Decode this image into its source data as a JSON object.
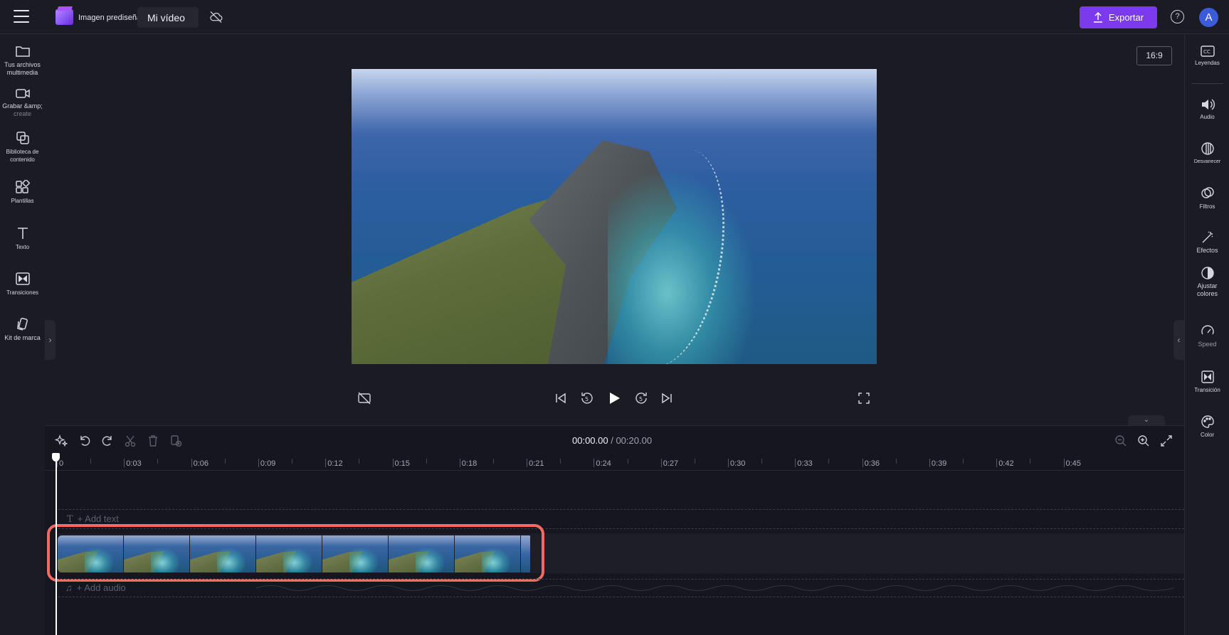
{
  "app": {
    "preset_label": "Imagen prediseñada",
    "project_title": "Mi vídeo",
    "export_label": "Exportar",
    "help": "?",
    "avatar_initial": "A",
    "accent": "#7c3aed",
    "highlight_color": "#f26a62"
  },
  "left_nav": [
    {
      "label": "Tus archivos multimedia",
      "icon": "folder-icon"
    },
    {
      "label": "Grabar &amp;",
      "sublabel": "create",
      "icon": "camera-icon"
    },
    {
      "label": "Biblioteca de contenido",
      "icon": "content-library-icon"
    },
    {
      "label": "Plantillas",
      "icon": "templates-icon"
    },
    {
      "label": "Texto",
      "icon": "text-icon"
    },
    {
      "label": "Transiciones",
      "icon": "transitions-icon"
    },
    {
      "label": "Kit de marca",
      "icon": "brand-kit-icon"
    }
  ],
  "right_nav": [
    {
      "label": "Leyendas",
      "icon": "captions-icon"
    },
    {
      "label": "Audio",
      "icon": "speaker-icon"
    },
    {
      "label": "Desvanecer",
      "icon": "fade-icon"
    },
    {
      "label": "Filtros",
      "icon": "filters-icon"
    },
    {
      "label": "Efectos",
      "icon": "magic-wand-icon"
    },
    {
      "label": "Ajustar colores",
      "icon": "adjust-colors-icon"
    },
    {
      "label": "Speed",
      "icon": "speed-icon"
    },
    {
      "label": "Transición",
      "icon": "transition-icon"
    },
    {
      "label": "Color",
      "icon": "palette-icon"
    }
  ],
  "preview": {
    "aspect_ratio": "16:9"
  },
  "timeline": {
    "current_time": "00:00.00",
    "separator": " / ",
    "total_time": "00:20.00",
    "ruler_labels": [
      "0",
      "0:03",
      "0:06",
      "0:09",
      "0:12",
      "0:15",
      "0:18",
      "0:21",
      "0:24",
      "0:27",
      "0:30",
      "0:33",
      "0:36",
      "0:39",
      "0:42",
      "0:45"
    ],
    "add_text": "+ Add text",
    "add_audio": "+ Add audio",
    "clip_thumbnails": 7
  }
}
